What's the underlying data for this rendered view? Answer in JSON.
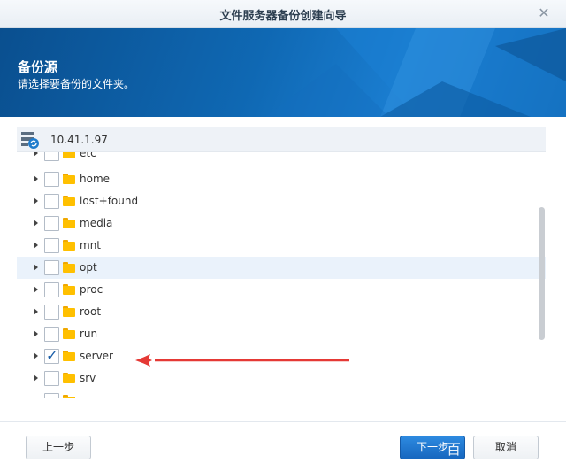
{
  "window": {
    "title": "文件服务器备份创建向导",
    "close_glyph": "✕"
  },
  "banner": {
    "heading": "备份源",
    "subtitle": "请选择要备份的文件夹。"
  },
  "server": {
    "ip": "10.41.1.97"
  },
  "folders": [
    {
      "name": "etc",
      "checked": false
    },
    {
      "name": "home",
      "checked": false
    },
    {
      "name": "lost+found",
      "checked": false
    },
    {
      "name": "media",
      "checked": false
    },
    {
      "name": "mnt",
      "checked": false
    },
    {
      "name": "opt",
      "checked": false,
      "highlighted": true
    },
    {
      "name": "proc",
      "checked": false
    },
    {
      "name": "root",
      "checked": false
    },
    {
      "name": "run",
      "checked": false
    },
    {
      "name": "server",
      "checked": true
    },
    {
      "name": "srv",
      "checked": false
    }
  ],
  "buttons": {
    "prev": "上一步",
    "next": "下一步",
    "cancel": "取消"
  },
  "watermark": "百",
  "colors": {
    "accent": "#1767bf",
    "banner": "#0f68b3",
    "folder": "#ffc000",
    "annotation_arrow": "#e53935"
  }
}
